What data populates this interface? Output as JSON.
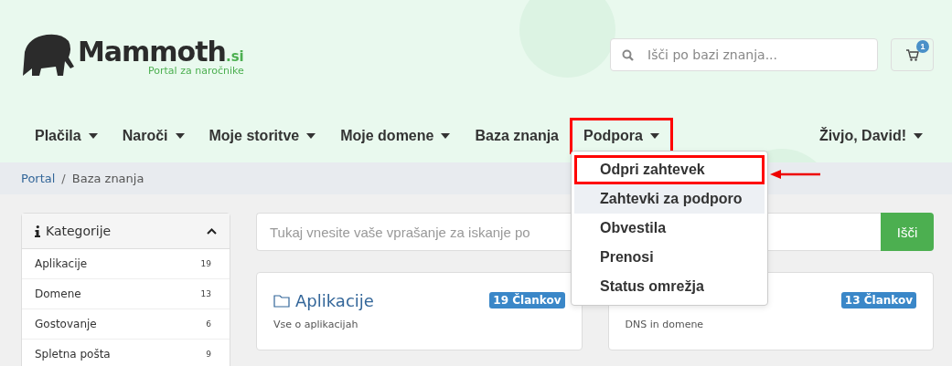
{
  "logo": {
    "name": "Mammoth",
    "suffix": ".si",
    "tagline": "Portal za naročnike"
  },
  "search": {
    "placeholder": "Išči po bazi znanja..."
  },
  "cart": {
    "count": "1"
  },
  "nav": [
    {
      "label": "Plačila",
      "caret": true,
      "highlighted": false
    },
    {
      "label": "Naroči",
      "caret": true,
      "highlighted": false
    },
    {
      "label": "Moje storitve",
      "caret": true,
      "highlighted": false
    },
    {
      "label": "Moje domene",
      "caret": true,
      "highlighted": false
    },
    {
      "label": "Baza znanja",
      "caret": false,
      "highlighted": false
    },
    {
      "label": "Podpora",
      "caret": true,
      "highlighted": true
    }
  ],
  "user_menu": {
    "label": "Živjo, David!"
  },
  "dropdown": [
    {
      "label": "Odpri zahtevek",
      "hovered": false,
      "highlighted": true
    },
    {
      "label": "Zahtevki za podporo",
      "hovered": true,
      "highlighted": false
    },
    {
      "label": "Obvestila",
      "hovered": false,
      "highlighted": false
    },
    {
      "label": "Prenosi",
      "hovered": false,
      "highlighted": false
    },
    {
      "label": "Status omrežja",
      "hovered": false,
      "highlighted": false
    }
  ],
  "breadcrumb": [
    {
      "label": "Portal",
      "link": true
    },
    {
      "separator": "/",
      "label": "Baza znanja",
      "link": false
    }
  ],
  "sidebar": {
    "title": "Kategorije",
    "expanded": true,
    "items": [
      {
        "label": "Aplikacije",
        "count": "19"
      },
      {
        "label": "Domene",
        "count": "13"
      },
      {
        "label": "Gostovanje",
        "count": "6"
      },
      {
        "label": "Spletna pošta",
        "count": "9"
      }
    ]
  },
  "kb_search": {
    "placeholder": "Tukaj vnesite vaše vprašanje za iskanje po",
    "button": "Išči"
  },
  "cards": [
    {
      "title": "Aplikacije",
      "badge": "19 Člankov",
      "description": "Vse o aplikacijah"
    },
    {
      "badge": "13 Člankov",
      "description": "DNS in domene"
    }
  ]
}
